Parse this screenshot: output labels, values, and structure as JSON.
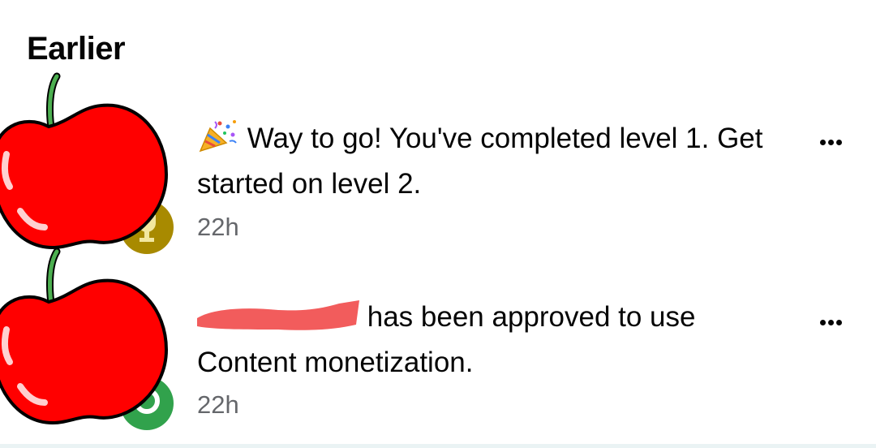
{
  "section": {
    "title": "Earlier"
  },
  "notifications": [
    {
      "message": "Way to go! You've completed level 1. Get started on level 2.",
      "time": "22h",
      "emoji": "party-popper-icon",
      "badge_icon": "trophy-icon",
      "badge_color": "#a88a00"
    },
    {
      "message_name": "",
      "message": "has been approved to use Content monetization.",
      "time": "22h",
      "badge_icon": "check-ring-icon",
      "badge_color": "#31a24c"
    }
  ],
  "colors": {
    "apple_red": "#ff0000",
    "apple_stem": "#4caf50",
    "redaction": "#f25c5c",
    "text_primary": "#050505",
    "text_secondary": "#65676b"
  }
}
